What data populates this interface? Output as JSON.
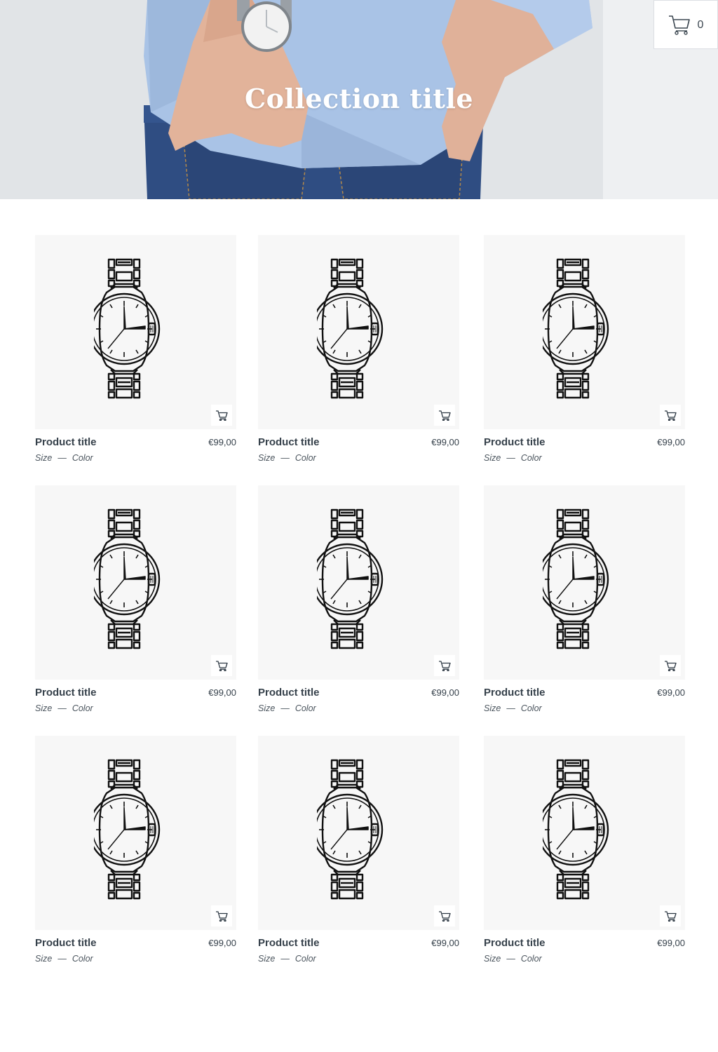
{
  "hero": {
    "title": "Collection title"
  },
  "cart": {
    "count": "0"
  },
  "colors": {
    "thumb_bg": "#f7f7f7",
    "text": "#36414b"
  },
  "products": [
    {
      "title": "Product title",
      "price": "€99,00",
      "size": "Size",
      "sep": "—",
      "color": "Color",
      "image": "watch-icon"
    },
    {
      "title": "Product title",
      "price": "€99,00",
      "size": "Size",
      "sep": "—",
      "color": "Color",
      "image": "watch-icon"
    },
    {
      "title": "Product title",
      "price": "€99,00",
      "size": "Size",
      "sep": "—",
      "color": "Color",
      "image": "watch-icon"
    },
    {
      "title": "Product title",
      "price": "€99,00",
      "size": "Size",
      "sep": "—",
      "color": "Color",
      "image": "watch-icon"
    },
    {
      "title": "Product title",
      "price": "€99,00",
      "size": "Size",
      "sep": "—",
      "color": "Color",
      "image": "watch-icon"
    },
    {
      "title": "Product title",
      "price": "€99,00",
      "size": "Size",
      "sep": "—",
      "color": "Color",
      "image": "watch-icon"
    },
    {
      "title": "Product title",
      "price": "€99,00",
      "size": "Size",
      "sep": "—",
      "color": "Color",
      "image": "watch-icon"
    },
    {
      "title": "Product title",
      "price": "€99,00",
      "size": "Size",
      "sep": "—",
      "color": "Color",
      "image": "watch-icon"
    },
    {
      "title": "Product title",
      "price": "€99,00",
      "size": "Size",
      "sep": "—",
      "color": "Color",
      "image": "watch-icon"
    }
  ]
}
